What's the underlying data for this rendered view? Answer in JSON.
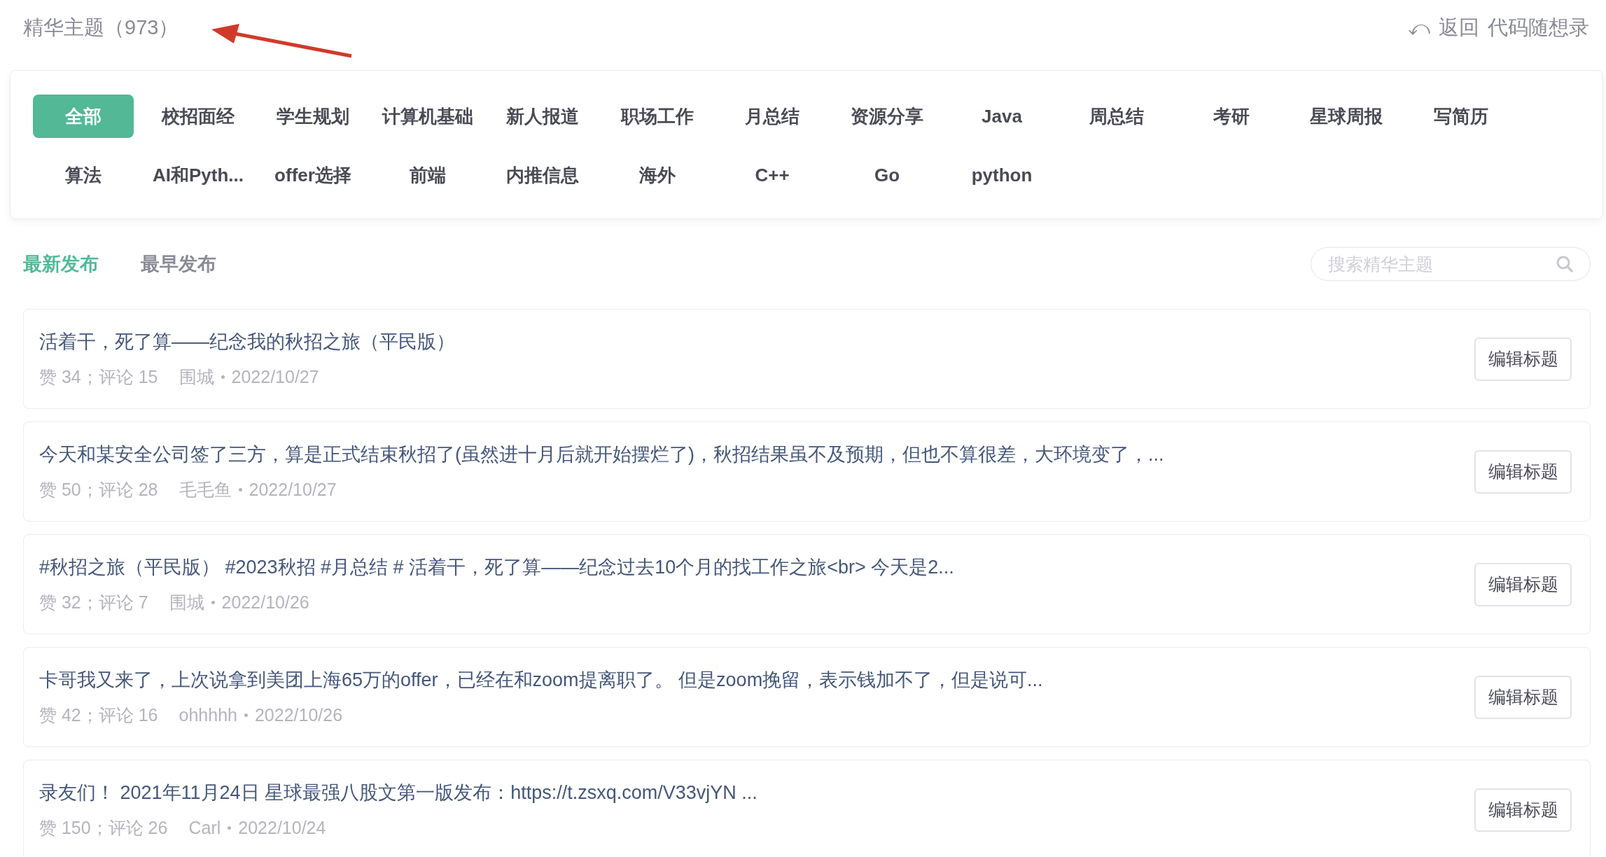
{
  "header": {
    "title": "精华主题（973）",
    "back_icon": "⤺",
    "back_label": "返回",
    "group_name": "代码随想录"
  },
  "categories": [
    {
      "label": "全部",
      "selected": true
    },
    {
      "label": "校招面经",
      "selected": false
    },
    {
      "label": "学生规划",
      "selected": false
    },
    {
      "label": "计算机基础",
      "selected": false
    },
    {
      "label": "新人报道",
      "selected": false
    },
    {
      "label": "职场工作",
      "selected": false
    },
    {
      "label": "月总结",
      "selected": false
    },
    {
      "label": "资源分享",
      "selected": false
    },
    {
      "label": "Java",
      "selected": false
    },
    {
      "label": "周总结",
      "selected": false
    },
    {
      "label": "考研",
      "selected": false
    },
    {
      "label": "星球周报",
      "selected": false
    },
    {
      "label": "写简历",
      "selected": false
    },
    {
      "label": "算法",
      "selected": false
    },
    {
      "label": "AI和Pyth...",
      "selected": false
    },
    {
      "label": "offer选择",
      "selected": false
    },
    {
      "label": "前端",
      "selected": false
    },
    {
      "label": "内推信息",
      "selected": false
    },
    {
      "label": "海外",
      "selected": false
    },
    {
      "label": "C++",
      "selected": false
    },
    {
      "label": "Go",
      "selected": false
    },
    {
      "label": "python",
      "selected": false
    }
  ],
  "sort_tabs": [
    {
      "label": "最新发布",
      "selected": true
    },
    {
      "label": "最早发布",
      "selected": false
    }
  ],
  "search": {
    "placeholder": "搜索精华主题"
  },
  "topics": [
    {
      "title": "活着干，死了算——纪念我的秋招之旅（平民版）",
      "stats": "赞 34；评论 15",
      "author": "围城",
      "date": "2022/10/27",
      "button": "编辑标题"
    },
    {
      "title": "今天和某安全公司签了三方，算是正式结束秋招了(虽然进十月后就开始摆烂了)，秋招结果虽不及预期，但也不算很差，大环境变了，...",
      "stats": "赞 50；评论 28",
      "author": "毛毛鱼",
      "date": "2022/10/27",
      "button": "编辑标题"
    },
    {
      "title": "#秋招之旅（平民版） #2023秋招 #月总结 # 活着干，死了算——纪念过去10个月的找工作之旅<br> 今天是2...",
      "stats": "赞 32；评论 7",
      "author": "围城",
      "date": "2022/10/26",
      "button": "编辑标题"
    },
    {
      "title": "卡哥我又来了，上次说拿到美团上海65万的offer，已经在和zoom提离职了。 但是zoom挽留，表示钱加不了，但是说可...",
      "stats": "赞 42；评论 16",
      "author": "ohhhhh",
      "date": "2022/10/26",
      "button": "编辑标题"
    },
    {
      "title": "录友们！ 2021年11月24日 星球最强八股文第一版发布：https://t.zsxq.com/V33vjYN ...",
      "stats": "赞 150；评论 26",
      "author": "Carl",
      "date": "2022/10/24",
      "button": "编辑标题"
    }
  ]
}
